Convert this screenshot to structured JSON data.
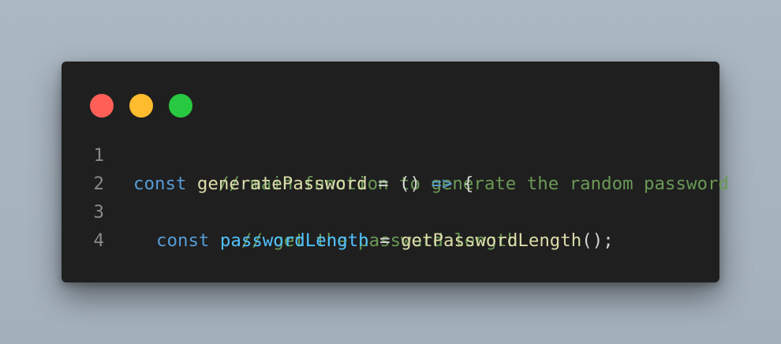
{
  "window": {
    "traffic_lights": [
      {
        "name": "close",
        "color": "#ff5f57"
      },
      {
        "name": "minimize",
        "color": "#febc2e"
      },
      {
        "name": "maximize",
        "color": "#28c840"
      }
    ]
  },
  "code": {
    "lines": [
      {
        "number": "1",
        "tokens": [
          {
            "text": "// main function to generate the random password",
            "type": "comment"
          }
        ]
      },
      {
        "number": "2",
        "tokens": [
          {
            "text": "const",
            "type": "keyword"
          },
          {
            "text": " ",
            "type": "plain"
          },
          {
            "text": "generatePassword",
            "type": "func"
          },
          {
            "text": " = () ",
            "type": "plain"
          },
          {
            "text": "=>",
            "type": "keyword"
          },
          {
            "text": " {",
            "type": "plain"
          }
        ]
      },
      {
        "number": "3",
        "tokens": [
          {
            "text": "// get the password length",
            "type": "comment"
          }
        ]
      },
      {
        "number": "4",
        "tokens": [
          {
            "text": "const",
            "type": "keyword"
          },
          {
            "text": " ",
            "type": "plain"
          },
          {
            "text": "passwordLength",
            "type": "var"
          },
          {
            "text": " = ",
            "type": "plain"
          },
          {
            "text": "getPasswordLength",
            "type": "func"
          },
          {
            "text": "();",
            "type": "plain"
          }
        ]
      }
    ]
  }
}
